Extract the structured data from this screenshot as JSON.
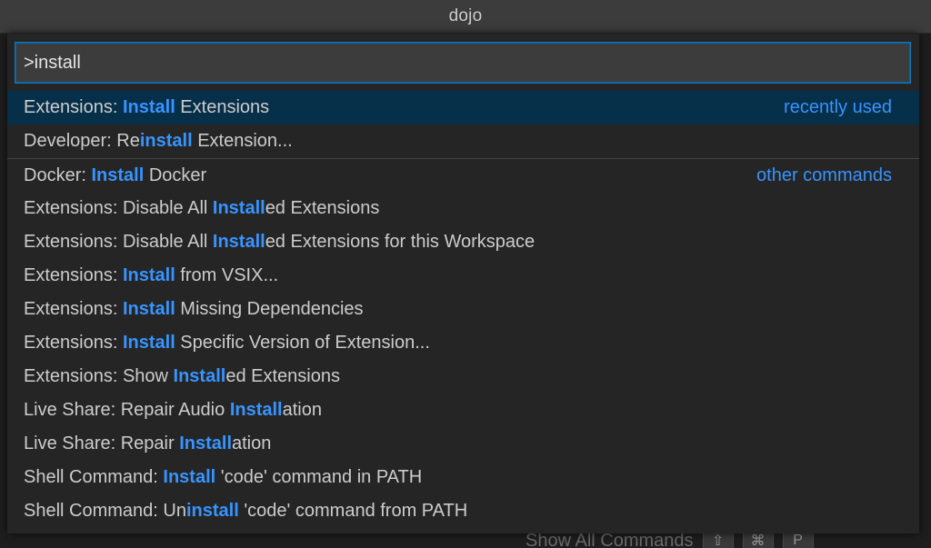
{
  "window": {
    "title": "dojo"
  },
  "background_hint": {
    "text": "Show All Commands",
    "keys": [
      "⇧",
      "⌘",
      "P"
    ]
  },
  "palette": {
    "input_value": ">install",
    "items": [
      {
        "parts": [
          "Extensions: ",
          "Install",
          " Extensions"
        ],
        "tag": "recently used",
        "selected": true,
        "separator": false
      },
      {
        "parts": [
          "Developer: Re",
          "install",
          " Extension..."
        ],
        "tag": "",
        "selected": false,
        "separator": false
      },
      {
        "parts": [
          "Docker: ",
          "Install",
          " Docker"
        ],
        "tag": "other commands",
        "selected": false,
        "separator": true
      },
      {
        "parts": [
          "Extensions: Disable All ",
          "Install",
          "ed Extensions"
        ],
        "tag": "",
        "selected": false,
        "separator": false
      },
      {
        "parts": [
          "Extensions: Disable All ",
          "Install",
          "ed Extensions for this Workspace"
        ],
        "tag": "",
        "selected": false,
        "separator": false
      },
      {
        "parts": [
          "Extensions: ",
          "Install",
          " from VSIX..."
        ],
        "tag": "",
        "selected": false,
        "separator": false
      },
      {
        "parts": [
          "Extensions: ",
          "Install",
          " Missing Dependencies"
        ],
        "tag": "",
        "selected": false,
        "separator": false
      },
      {
        "parts": [
          "Extensions: ",
          "Install",
          " Specific Version of Extension..."
        ],
        "tag": "",
        "selected": false,
        "separator": false
      },
      {
        "parts": [
          "Extensions: Show ",
          "Install",
          "ed Extensions"
        ],
        "tag": "",
        "selected": false,
        "separator": false
      },
      {
        "parts": [
          "Live Share: Repair Audio ",
          "Install",
          "ation"
        ],
        "tag": "",
        "selected": false,
        "separator": false
      },
      {
        "parts": [
          "Live Share: Repair ",
          "Install",
          "ation"
        ],
        "tag": "",
        "selected": false,
        "separator": false
      },
      {
        "parts": [
          "Shell Command: ",
          "Install",
          " 'code' command in PATH"
        ],
        "tag": "",
        "selected": false,
        "separator": false
      },
      {
        "parts": [
          "Shell Command: Un",
          "install",
          " 'code' command from PATH"
        ],
        "tag": "",
        "selected": false,
        "separator": false
      }
    ]
  },
  "colors": {
    "highlight": "#3794ff",
    "selected_row": "#062f4a",
    "panel": "#252526",
    "focus_border": "#0e639c"
  }
}
